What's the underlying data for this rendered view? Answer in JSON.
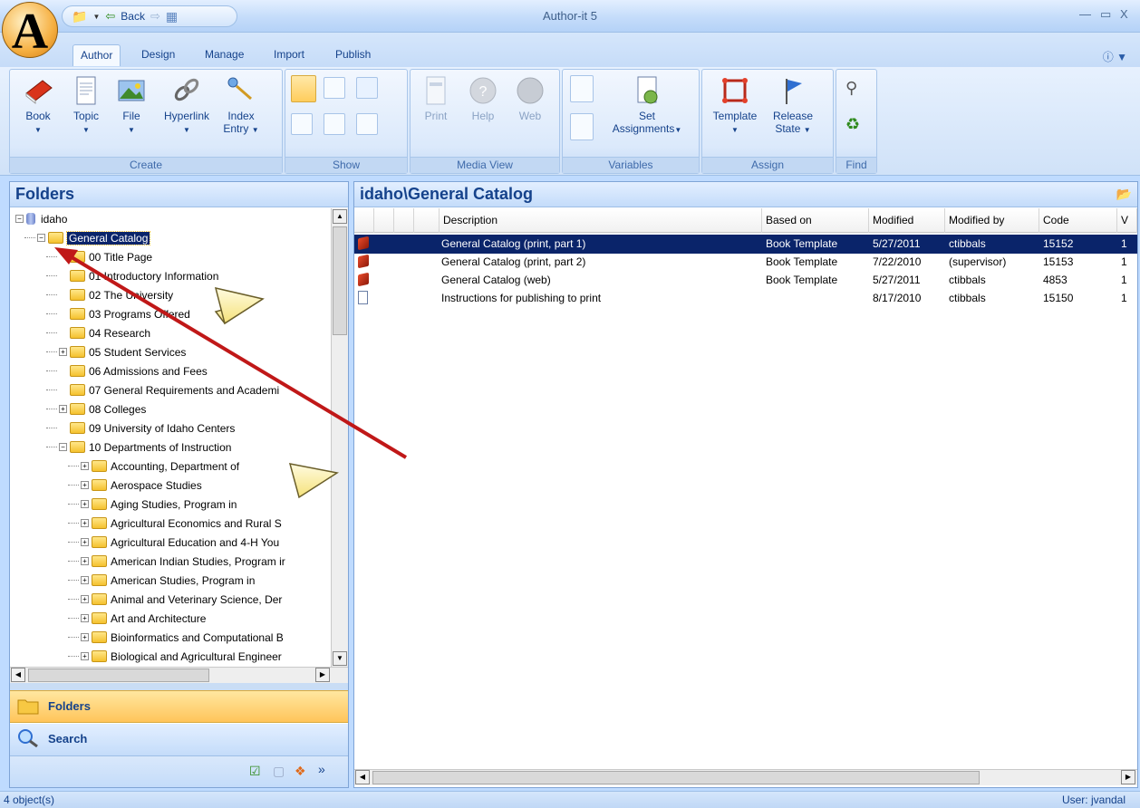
{
  "window": {
    "title": "Author-it 5",
    "logo_letter": "A"
  },
  "qat": {
    "back_label": "Back"
  },
  "ribbon_tabs": [
    "Author",
    "Design",
    "Manage",
    "Import",
    "Publish"
  ],
  "ribbon": {
    "groups": {
      "create": "Create",
      "show": "Show",
      "media_view": "Media View",
      "variables": "Variables",
      "assign": "Assign",
      "find": "Find"
    },
    "create": {
      "book": "Book",
      "topic": "Topic",
      "file": "File",
      "hyperlink": "Hyperlink",
      "index_line1": "Index",
      "index_line2": "Entry"
    },
    "media": {
      "print": "Print",
      "help": "Help",
      "web": "Web"
    },
    "variables": {
      "set_line1": "Set",
      "set_line2": "Assignments"
    },
    "assign": {
      "template": "Template",
      "release_line1": "Release",
      "release_line2": "State"
    }
  },
  "left_pane": {
    "title": "Folders",
    "tree": [
      {
        "label": "idaho",
        "level": 0,
        "expander": "minus",
        "icon": "database"
      },
      {
        "label": "General Catalog",
        "level": 1,
        "expander": "minus",
        "icon": "folder-open",
        "selected": true
      },
      {
        "label": "00 Title Page",
        "level": 2,
        "expander": "",
        "icon": "folder"
      },
      {
        "label": "01 Introductory Information",
        "level": 2,
        "expander": "",
        "icon": "folder"
      },
      {
        "label": "02 The University",
        "level": 2,
        "expander": "",
        "icon": "folder"
      },
      {
        "label": "03 Programs Offered",
        "level": 2,
        "expander": "",
        "icon": "folder"
      },
      {
        "label": "04 Research",
        "level": 2,
        "expander": "",
        "icon": "folder"
      },
      {
        "label": "05 Student Services",
        "level": 2,
        "expander": "plus",
        "icon": "folder"
      },
      {
        "label": "06 Admissions and Fees",
        "level": 2,
        "expander": "",
        "icon": "folder"
      },
      {
        "label": "07 General Requirements and Academi",
        "level": 2,
        "expander": "",
        "icon": "folder"
      },
      {
        "label": "08 Colleges",
        "level": 2,
        "expander": "plus",
        "icon": "folder"
      },
      {
        "label": "09 University of Idaho Centers",
        "level": 2,
        "expander": "",
        "icon": "folder"
      },
      {
        "label": "10 Departments of Instruction",
        "level": 2,
        "expander": "minus",
        "icon": "folder-open"
      },
      {
        "label": "Accounting, Department of",
        "level": 3,
        "expander": "plus",
        "icon": "folder"
      },
      {
        "label": "Aerospace Studies",
        "level": 3,
        "expander": "plus",
        "icon": "folder"
      },
      {
        "label": "Aging Studies, Program in",
        "level": 3,
        "expander": "plus",
        "icon": "folder"
      },
      {
        "label": "Agricultural Economics and Rural S",
        "level": 3,
        "expander": "plus",
        "icon": "folder"
      },
      {
        "label": "Agricultural Education and 4-H You",
        "level": 3,
        "expander": "plus",
        "icon": "folder"
      },
      {
        "label": "American Indian Studies, Program ir",
        "level": 3,
        "expander": "plus",
        "icon": "folder"
      },
      {
        "label": "American Studies, Program in",
        "level": 3,
        "expander": "plus",
        "icon": "folder"
      },
      {
        "label": "Animal and Veterinary Science, Der",
        "level": 3,
        "expander": "plus",
        "icon": "folder"
      },
      {
        "label": "Art and Architecture",
        "level": 3,
        "expander": "plus",
        "icon": "folder"
      },
      {
        "label": "Bioinformatics and Computational B",
        "level": 3,
        "expander": "plus",
        "icon": "folder"
      },
      {
        "label": "Biological and Agricultural Engineer",
        "level": 3,
        "expander": "plus",
        "icon": "folder"
      }
    ],
    "nav_buttons": {
      "folders": "Folders",
      "search": "Search"
    }
  },
  "right_pane": {
    "title": "idaho\\General Catalog",
    "columns": [
      "Description",
      "Based on",
      "Modified",
      "Modified by",
      "Code",
      "V"
    ],
    "rows": [
      {
        "icon": "book-icon",
        "description": "General Catalog (print, part 1)",
        "based_on": "Book Template",
        "modified": "5/27/2011",
        "modified_by": "ctibbals",
        "code": "15152",
        "v": "1",
        "selected": true
      },
      {
        "icon": "book-icon",
        "description": "General Catalog (print, part 2)",
        "based_on": "Book Template",
        "modified": "7/22/2010",
        "modified_by": "(supervisor)",
        "code": "15153",
        "v": "1"
      },
      {
        "icon": "book-icon",
        "description": "General Catalog (web)",
        "based_on": "Book Template",
        "modified": "5/27/2011",
        "modified_by": "ctibbals",
        "code": "4853",
        "v": "1"
      },
      {
        "icon": "topic-icon",
        "description": "Instructions for publishing to print",
        "based_on": "",
        "modified": "8/17/2010",
        "modified_by": "ctibbals",
        "code": "15150",
        "v": "1"
      }
    ]
  },
  "status": {
    "count": "4 object(s)",
    "user": "User: jvandal"
  },
  "colors": {
    "selection": "#0a246a",
    "arrow": "#c01818",
    "ribbon_text": "#15428b"
  }
}
